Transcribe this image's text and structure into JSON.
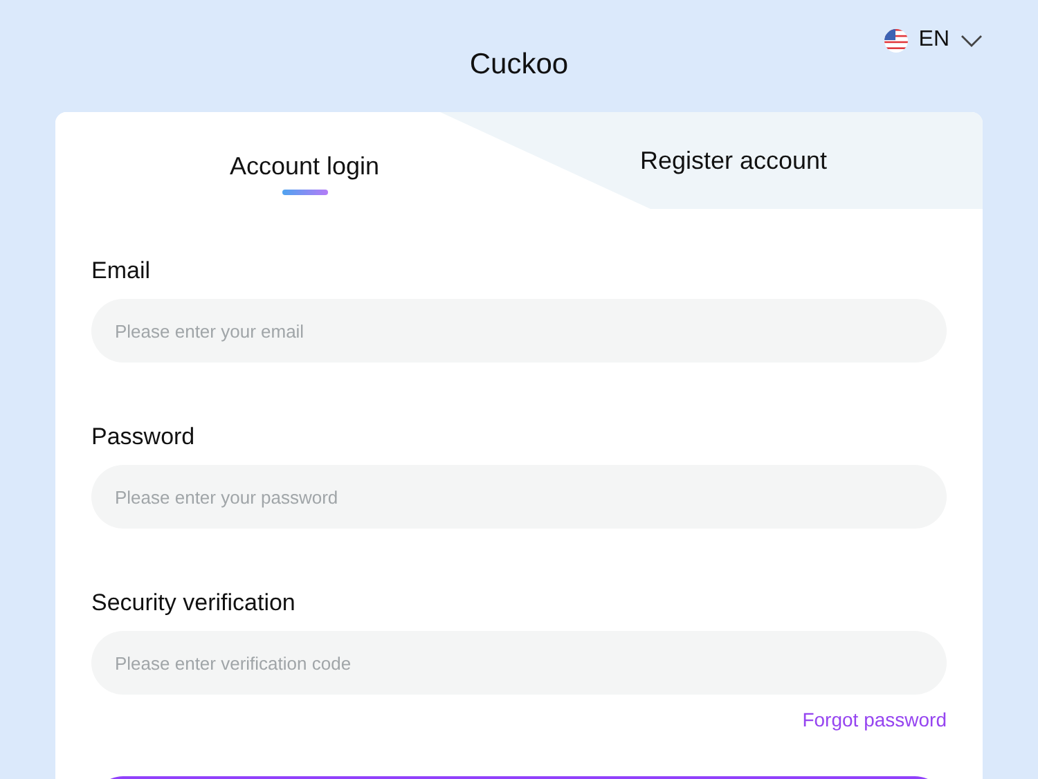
{
  "header": {
    "title": "Cuckoo",
    "language": {
      "code": "EN"
    }
  },
  "tabs": [
    {
      "label": "Account login",
      "selected": true
    },
    {
      "label": "Register account",
      "selected": false
    }
  ],
  "fields": [
    {
      "label": "Email",
      "placeholder": "Please enter your email"
    },
    {
      "label": "Password",
      "placeholder": "Please enter your password"
    },
    {
      "label": "Security verification",
      "placeholder": "Please enter verification code"
    }
  ],
  "forgot_link": "Forgot password"
}
